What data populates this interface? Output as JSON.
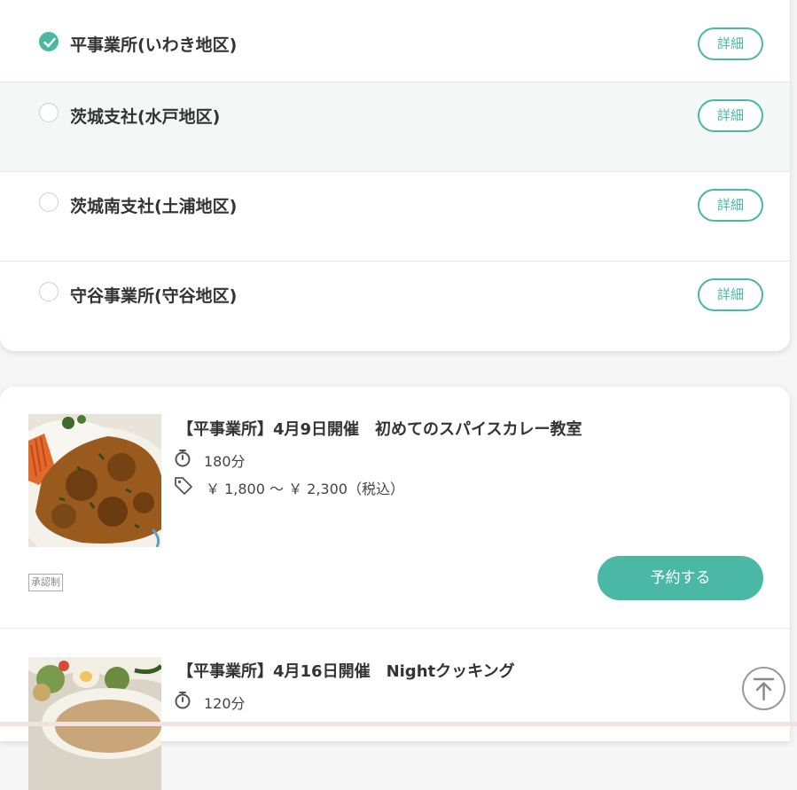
{
  "locations": [
    {
      "name": "平事業所(いわき地区)",
      "selected": true,
      "detail_label": "詳細"
    },
    {
      "name": "茨城支社(水戸地区)",
      "selected": false,
      "detail_label": "詳細"
    },
    {
      "name": "茨城南支社(土浦地区)",
      "selected": false,
      "detail_label": "詳細"
    },
    {
      "name": "守谷事業所(守谷地区)",
      "selected": false,
      "detail_label": "詳細"
    }
  ],
  "courses": [
    {
      "title": "【平事業所】4月9日開催　初めてのスパイスカレー教室",
      "duration": "180分",
      "price": "￥ 1,800 〜 ￥ 2,300（税込）",
      "badge": "承認制",
      "reserve_label": "予約する"
    },
    {
      "title": "【平事業所】4月16日開催　Nightクッキング",
      "duration": "120分"
    }
  ],
  "colors": {
    "accent": "#4ab8a5",
    "row_highlight": "#f3f8f7"
  },
  "icons": {
    "check": "check-icon",
    "timer": "stopwatch-icon",
    "price": "price-tag-icon",
    "top": "arrow-up-to-top-icon"
  }
}
